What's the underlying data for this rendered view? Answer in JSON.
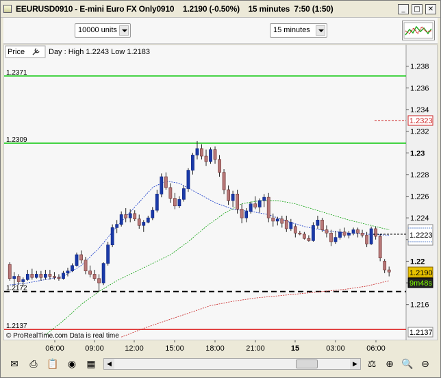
{
  "window": {
    "title": "EEURUSD0910 - E-mini Euro FX Only0910    1.2190 (-0.50%)    15 minutes  7:50 (1:50)",
    "buttons": {
      "minimize": "_",
      "maximize": "□",
      "close": "✕"
    }
  },
  "toolbar": {
    "quantity": "10000 units",
    "timeframe": "15 minutes"
  },
  "chart": {
    "price_label": "Price",
    "day_info": "Day : High 1.2243 Low 1.2183",
    "footer": "© ProRealTime.com  Data is real time",
    "y_ticks": [
      "1.238",
      "1.236",
      "1.234",
      "1.232",
      "1.23",
      "1.228",
      "1.226",
      "1.224",
      "1.222",
      "1.22",
      "1.218",
      "1.216"
    ],
    "x_ticks": [
      "06:00",
      "09:00",
      "12:00",
      "15:00",
      "18:00",
      "21:00",
      "15",
      "03:00",
      "06:00"
    ],
    "hlines": [
      {
        "price": 1.2371,
        "label": "1.2371",
        "color": "#22cc22",
        "style": "solid"
      },
      {
        "price": 1.2309,
        "label": "1.2309",
        "color": "#22cc22",
        "style": "solid"
      },
      {
        "price": 1.2172,
        "label": "1.2172",
        "color": "#000000",
        "style": "dash"
      },
      {
        "price": 1.2137,
        "label": "1.2137",
        "color": "#dd2222",
        "style": "solid"
      }
    ],
    "badges": {
      "red_level": "1.2323",
      "lines_level": "1.2223",
      "last_price": "1.2190",
      "countdown": "9m48s",
      "bottom_level": "1.2137"
    }
  },
  "chart_data": {
    "type": "candlestick",
    "title": "EEURUSD0910 - E-mini Euro FX Only0910",
    "xlabel": "",
    "ylabel": "",
    "ylim": [
      1.2132,
      1.2395
    ],
    "x_ticks": [
      "06:00",
      "09:00",
      "12:00",
      "15:00",
      "18:00",
      "21:00",
      "15",
      "03:00",
      "06:00"
    ],
    "candles": [
      [
        1.2197,
        1.2199,
        1.2182,
        1.2184
      ],
      [
        1.2184,
        1.219,
        1.2178,
        1.2186
      ],
      [
        1.2186,
        1.2188,
        1.2178,
        1.2181
      ],
      [
        1.2181,
        1.2185,
        1.2177,
        1.2183
      ],
      [
        1.2183,
        1.2192,
        1.2182,
        1.2188
      ],
      [
        1.2188,
        1.2193,
        1.2183,
        1.2185
      ],
      [
        1.2185,
        1.2191,
        1.2184,
        1.2188
      ],
      [
        1.2188,
        1.2191,
        1.2182,
        1.2185
      ],
      [
        1.2185,
        1.2192,
        1.2183,
        1.2188
      ],
      [
        1.2188,
        1.2192,
        1.2183,
        1.2186
      ],
      [
        1.2186,
        1.219,
        1.2183,
        1.2185
      ],
      [
        1.2185,
        1.2188,
        1.2182,
        1.2184
      ],
      [
        1.2184,
        1.2191,
        1.2183,
        1.2189
      ],
      [
        1.2189,
        1.2194,
        1.2186,
        1.2191
      ],
      [
        1.2191,
        1.2198,
        1.219,
        1.2196
      ],
      [
        1.2196,
        1.2208,
        1.2195,
        1.2206
      ],
      [
        1.2206,
        1.221,
        1.2198,
        1.2201
      ],
      [
        1.2201,
        1.2204,
        1.2188,
        1.2191
      ],
      [
        1.2191,
        1.2196,
        1.2185,
        1.2188
      ],
      [
        1.2188,
        1.2192,
        1.2182,
        1.2184
      ],
      [
        1.2184,
        1.2188,
        1.2172,
        1.218
      ],
      [
        1.218,
        1.2199,
        1.2178,
        1.2198
      ],
      [
        1.2198,
        1.2218,
        1.2196,
        1.2215
      ],
      [
        1.2215,
        1.2234,
        1.2213,
        1.2231
      ],
      [
        1.2231,
        1.2238,
        1.2226,
        1.2234
      ],
      [
        1.2234,
        1.2246,
        1.2232,
        1.2243
      ],
      [
        1.2243,
        1.2249,
        1.2236,
        1.224
      ],
      [
        1.224,
        1.2248,
        1.2236,
        1.2244
      ],
      [
        1.2244,
        1.2247,
        1.2237,
        1.2239
      ],
      [
        1.2239,
        1.2243,
        1.223,
        1.2233
      ],
      [
        1.2233,
        1.2238,
        1.2227,
        1.2236
      ],
      [
        1.2236,
        1.2242,
        1.2235,
        1.224
      ],
      [
        1.224,
        1.225,
        1.2238,
        1.2247
      ],
      [
        1.2247,
        1.2266,
        1.2245,
        1.2262
      ],
      [
        1.2262,
        1.2281,
        1.2259,
        1.2278
      ],
      [
        1.2278,
        1.2282,
        1.2266,
        1.2268
      ],
      [
        1.2268,
        1.2272,
        1.2254,
        1.2258
      ],
      [
        1.2258,
        1.2263,
        1.2248,
        1.2251
      ],
      [
        1.2251,
        1.226,
        1.2249,
        1.2257
      ],
      [
        1.2257,
        1.227,
        1.2255,
        1.2267
      ],
      [
        1.2267,
        1.2286,
        1.2264,
        1.2284
      ],
      [
        1.2284,
        1.23,
        1.228,
        1.2298
      ],
      [
        1.2298,
        1.2311,
        1.2294,
        1.2304
      ],
      [
        1.2304,
        1.2308,
        1.2294,
        1.2297
      ],
      [
        1.2297,
        1.2303,
        1.2288,
        1.2292
      ],
      [
        1.2292,
        1.2305,
        1.229,
        1.2303
      ],
      [
        1.2303,
        1.2306,
        1.229,
        1.2294
      ],
      [
        1.2294,
        1.2298,
        1.2278,
        1.2282
      ],
      [
        1.2282,
        1.2285,
        1.2262,
        1.2266
      ],
      [
        1.2266,
        1.227,
        1.2252,
        1.2256
      ],
      [
        1.2256,
        1.2265,
        1.225,
        1.2262
      ],
      [
        1.2262,
        1.2266,
        1.2244,
        1.2248
      ],
      [
        1.2248,
        1.2253,
        1.2235,
        1.224
      ],
      [
        1.224,
        1.2249,
        1.2236,
        1.2246
      ],
      [
        1.2246,
        1.2255,
        1.2244,
        1.2253
      ],
      [
        1.2253,
        1.226,
        1.2248,
        1.225
      ],
      [
        1.225,
        1.2258,
        1.2245,
        1.2256
      ],
      [
        1.2256,
        1.2262,
        1.225,
        1.2259
      ],
      [
        1.2259,
        1.2263,
        1.2236,
        1.224
      ],
      [
        1.224,
        1.2244,
        1.2232,
        1.2237
      ],
      [
        1.2237,
        1.2241,
        1.2233,
        1.2239
      ],
      [
        1.2239,
        1.2242,
        1.2231,
        1.2235
      ]
    ],
    "candles_2": [
      [
        1.2238,
        1.2242,
        1.2227,
        1.223
      ],
      [
        1.223,
        1.2239,
        1.2228,
        1.2236
      ],
      [
        1.2232,
        1.2234,
        1.2222,
        1.2226
      ],
      [
        1.2226,
        1.2228,
        1.2224,
        1.2225
      ],
      [
        1.2225,
        1.2227,
        1.222,
        1.2221
      ],
      [
        1.2221,
        1.2224,
        1.2218,
        1.2219
      ],
      [
        1.2219,
        1.2236,
        1.2218,
        1.2233
      ],
      [
        1.2233,
        1.2242,
        1.223,
        1.2238
      ],
      [
        1.2238,
        1.224,
        1.2227,
        1.2229
      ],
      [
        1.2229,
        1.2233,
        1.2222,
        1.2226
      ],
      [
        1.2226,
        1.2229,
        1.2214,
        1.2218
      ],
      [
        1.2218,
        1.2228,
        1.2216,
        1.2222
      ],
      [
        1.2222,
        1.223,
        1.222,
        1.2227
      ],
      [
        1.2227,
        1.2231,
        1.2222,
        1.2224
      ],
      [
        1.2224,
        1.2228,
        1.2221,
        1.2226
      ],
      [
        1.2226,
        1.2231,
        1.2224,
        1.2229
      ],
      [
        1.2229,
        1.2231,
        1.2222,
        1.2226
      ],
      [
        1.2226,
        1.2229,
        1.2222,
        1.2224
      ],
      [
        1.2224,
        1.2227,
        1.2213,
        1.2216
      ],
      [
        1.2216,
        1.2232,
        1.2215,
        1.223
      ],
      [
        1.223,
        1.2232,
        1.222,
        1.2223
      ],
      [
        1.2223,
        1.2225,
        1.22,
        1.2203
      ],
      [
        1.22,
        1.2202,
        1.2189,
        1.2192
      ],
      [
        1.2192,
        1.2195,
        1.2186,
        1.219
      ]
    ],
    "series": [
      {
        "name": "",
        "color": "#2244cc",
        "values": [
          [
            0,
            1.2178
          ],
          [
            8,
            1.218
          ],
          [
            16,
            1.2183
          ],
          [
            24,
            1.2186
          ],
          [
            32,
            1.2196
          ],
          [
            40,
            1.2212
          ],
          [
            48,
            1.2232
          ],
          [
            56,
            1.225
          ],
          [
            64,
            1.2268
          ],
          [
            70,
            1.2274
          ],
          [
            76,
            1.2272
          ],
          [
            84,
            1.2263
          ],
          [
            92,
            1.2254
          ],
          [
            100,
            1.2248
          ],
          [
            108,
            1.2246
          ],
          [
            116,
            1.2243
          ],
          [
            124,
            1.2237
          ],
          [
            132,
            1.2232
          ],
          [
            142,
            1.2228
          ],
          [
            152,
            1.2226
          ],
          [
            160,
            1.2225
          ],
          [
            170,
            1.2224
          ]
        ]
      },
      {
        "name": "",
        "color": "#22aa22",
        "values": [
          [
            16,
            1.2132
          ],
          [
            24,
            1.2145
          ],
          [
            32,
            1.216
          ],
          [
            40,
            1.2172
          ],
          [
            48,
            1.2182
          ],
          [
            56,
            1.219
          ],
          [
            64,
            1.2198
          ],
          [
            72,
            1.2206
          ],
          [
            80,
            1.2218
          ],
          [
            88,
            1.2232
          ],
          [
            96,
            1.2244
          ],
          [
            104,
            1.2253
          ],
          [
            112,
            1.2256
          ],
          [
            120,
            1.2256
          ],
          [
            128,
            1.2253
          ],
          [
            136,
            1.2248
          ],
          [
            144,
            1.2243
          ],
          [
            152,
            1.2238
          ],
          [
            160,
            1.2234
          ],
          [
            170,
            1.2229
          ]
        ]
      },
      {
        "name": "",
        "color": "#cc3333",
        "values": [
          [
            50,
            1.213
          ],
          [
            60,
            1.2138
          ],
          [
            70,
            1.2145
          ],
          [
            80,
            1.2152
          ],
          [
            90,
            1.2159
          ],
          [
            100,
            1.2163
          ],
          [
            110,
            1.2166
          ],
          [
            120,
            1.2168
          ],
          [
            130,
            1.217
          ],
          [
            140,
            1.2172
          ],
          [
            150,
            1.2174
          ],
          [
            160,
            1.2177
          ],
          [
            170,
            1.2182
          ]
        ]
      }
    ]
  }
}
